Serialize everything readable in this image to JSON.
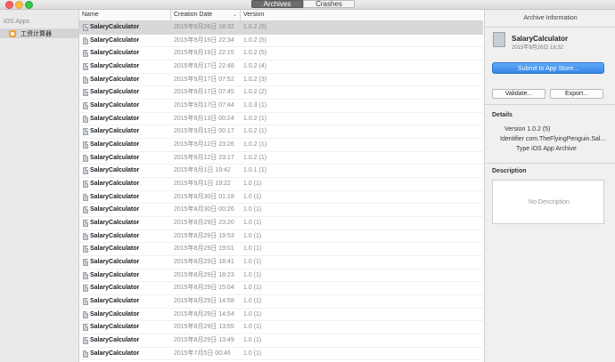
{
  "toolbar": {
    "tabs": [
      {
        "label": "Archives",
        "active": true
      },
      {
        "label": "Crashes",
        "active": false
      }
    ]
  },
  "sidebar": {
    "header": "iOS Apps",
    "items": [
      {
        "label": "工资计算器",
        "icon": "app-icon"
      }
    ]
  },
  "table": {
    "columns": {
      "name": "Name",
      "date": "Creation Date",
      "version": "Version"
    },
    "sort_icon": "chevron-down-icon",
    "rows": [
      {
        "name": "SalaryCalculator",
        "date": "2015年9月26日 18:32",
        "version": "1.0.2 (5)",
        "selected": true
      },
      {
        "name": "SalaryCalculator",
        "date": "2015年9月19日 22:34",
        "version": "1.0.2 (5)"
      },
      {
        "name": "SalaryCalculator",
        "date": "2015年9月19日 22:15",
        "version": "1.0.2 (5)"
      },
      {
        "name": "SalaryCalculator",
        "date": "2015年9月17日 22:48",
        "version": "1.0.2 (4)"
      },
      {
        "name": "SalaryCalculator",
        "date": "2015年9月17日 07:52",
        "version": "1.0.2 (3)"
      },
      {
        "name": "SalaryCalculator",
        "date": "2015年9月17日 07:45",
        "version": "1.0.2 (2)"
      },
      {
        "name": "SalaryCalculator",
        "date": "2015年9月17日 07:44",
        "version": "1.0.3 (1)"
      },
      {
        "name": "SalaryCalculator",
        "date": "2015年9月13日 00:24",
        "version": "1.0.2 (1)"
      },
      {
        "name": "SalaryCalculator",
        "date": "2015年9月13日 00:17",
        "version": "1.0.2 (1)"
      },
      {
        "name": "SalaryCalculator",
        "date": "2015年9月12日 23:26",
        "version": "1.0.2 (1)"
      },
      {
        "name": "SalaryCalculator",
        "date": "2015年9月12日 23:17",
        "version": "1.0.2 (1)"
      },
      {
        "name": "SalaryCalculator",
        "date": "2015年9月1日 19:42",
        "version": "1.0.1 (1)"
      },
      {
        "name": "SalaryCalculator",
        "date": "2015年9月1日 19:22",
        "version": "1.0 (1)"
      },
      {
        "name": "SalaryCalculator",
        "date": "2015年8月30日 01:18",
        "version": "1.0 (1)"
      },
      {
        "name": "SalaryCalculator",
        "date": "2015年8月30日 00:26",
        "version": "1.0 (1)"
      },
      {
        "name": "SalaryCalculator",
        "date": "2015年8月29日 23:20",
        "version": "1.0 (1)"
      },
      {
        "name": "SalaryCalculator",
        "date": "2015年8月29日 19:53",
        "version": "1.0 (1)"
      },
      {
        "name": "SalaryCalculator",
        "date": "2015年8月29日 19:01",
        "version": "1.0 (1)"
      },
      {
        "name": "SalaryCalculator",
        "date": "2015年8月29日 18:41",
        "version": "1.0 (1)"
      },
      {
        "name": "SalaryCalculator",
        "date": "2015年8月29日 18:23",
        "version": "1.0 (1)"
      },
      {
        "name": "SalaryCalculator",
        "date": "2015年8月29日 15:04",
        "version": "1.0 (1)"
      },
      {
        "name": "SalaryCalculator",
        "date": "2015年8月29日 14:58",
        "version": "1.0 (1)"
      },
      {
        "name": "SalaryCalculator",
        "date": "2015年8月29日 14:54",
        "version": "1.0 (1)"
      },
      {
        "name": "SalaryCalculator",
        "date": "2015年8月29日 13:55",
        "version": "1.0 (1)"
      },
      {
        "name": "SalaryCalculator",
        "date": "2015年8月29日 13:49",
        "version": "1.0 (1)"
      },
      {
        "name": "SalaryCalculator",
        "date": "2015年7月5日 00:46",
        "version": "1.0 (1)"
      }
    ]
  },
  "inspector": {
    "title": "Archive Information",
    "archive_name": "SalaryCalculator",
    "archive_date": "2015年9月26日 18:32",
    "submit_label": "Submit to App Store...",
    "validate_label": "Validate...",
    "export_label": "Export...",
    "details_title": "Details",
    "version_label": "Version",
    "version_value": "1.0.2 (5)",
    "identifier_label": "Identifier",
    "identifier_value": "com.TheFlyingPenguin.Sal...",
    "type_label": "Type",
    "type_value": "iOS App Archive",
    "description_title": "Description",
    "description_placeholder": "No Description"
  },
  "colors": {
    "accent": "#3887ea",
    "selection": "#d8d8d8",
    "sidebar_bg": "#eaeaea"
  }
}
